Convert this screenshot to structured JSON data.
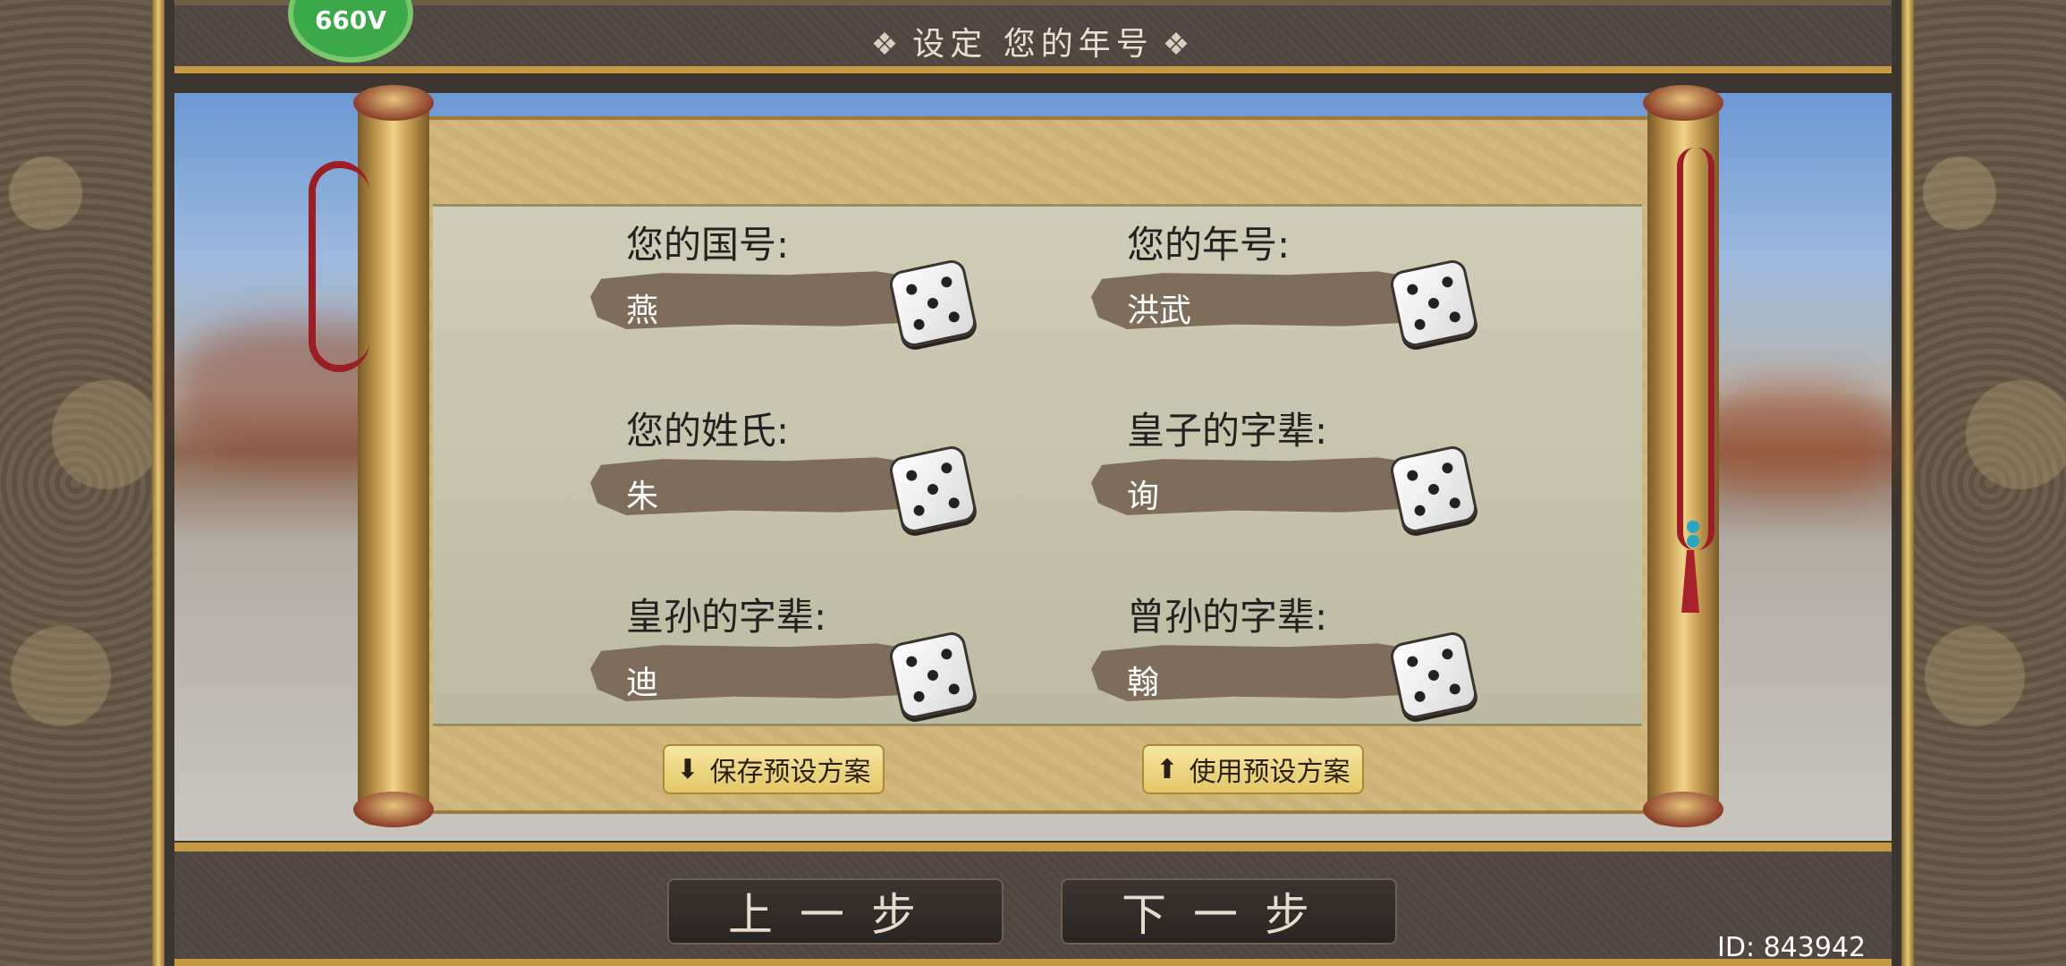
{
  "header": {
    "title": "设定 您的年号",
    "logo_text": "660V"
  },
  "fields": [
    {
      "label": "您的国号:",
      "value": "燕"
    },
    {
      "label": "您的年号:",
      "value": "洪武"
    },
    {
      "label": "您的姓氏:",
      "value": "朱"
    },
    {
      "label": "皇子的字辈:",
      "value": "询"
    },
    {
      "label": "皇孙的字辈:",
      "value": "迪"
    },
    {
      "label": "曾孙的字辈:",
      "value": "翰"
    }
  ],
  "presets": {
    "save_label": "保存预设方案",
    "use_label": "使用预设方案"
  },
  "nav": {
    "prev_label": "上一步",
    "next_label": "下一步"
  },
  "footer": {
    "id_text": "ID: 843942"
  }
}
